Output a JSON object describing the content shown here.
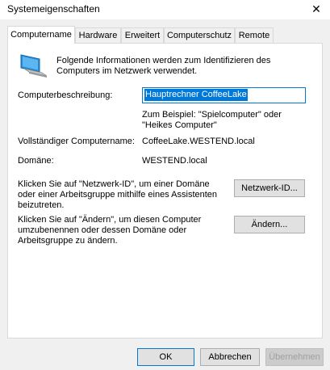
{
  "window": {
    "title": "Systemeigenschaften",
    "close": "✕"
  },
  "tabs": [
    "Computername",
    "Hardware",
    "Erweitert",
    "Computerschutz",
    "Remote"
  ],
  "intro": "Folgende Informationen werden zum Identifizieren des Computers im Netzwerk verwendet.",
  "description": {
    "label": "Computerbeschreibung:",
    "value": "Hauptrechner CoffeeLake",
    "example": "Zum Beispiel: \"Spielcomputer\" oder \"Heikes Computer\""
  },
  "fullname": {
    "label": "Vollständiger Computername:",
    "value": "CoffeeLake.WESTEND.local"
  },
  "domain": {
    "label": "Domäne:",
    "value": "WESTEND.local"
  },
  "netid": {
    "text": "Klicken Sie auf \"Netzwerk-ID\", um einer Domäne oder einer Arbeitsgruppe mithilfe eines Assistenten beizutreten.",
    "button": "Netzwerk-ID..."
  },
  "change": {
    "text": "Klicken Sie auf \"Ändern\", um diesen Computer umzubenennen oder dessen Domäne oder Arbeitsgruppe zu ändern.",
    "button": "Ändern..."
  },
  "footer": {
    "ok": "OK",
    "cancel": "Abbrechen",
    "apply": "Übernehmen"
  },
  "icons": {
    "computer": "computer-icon"
  }
}
